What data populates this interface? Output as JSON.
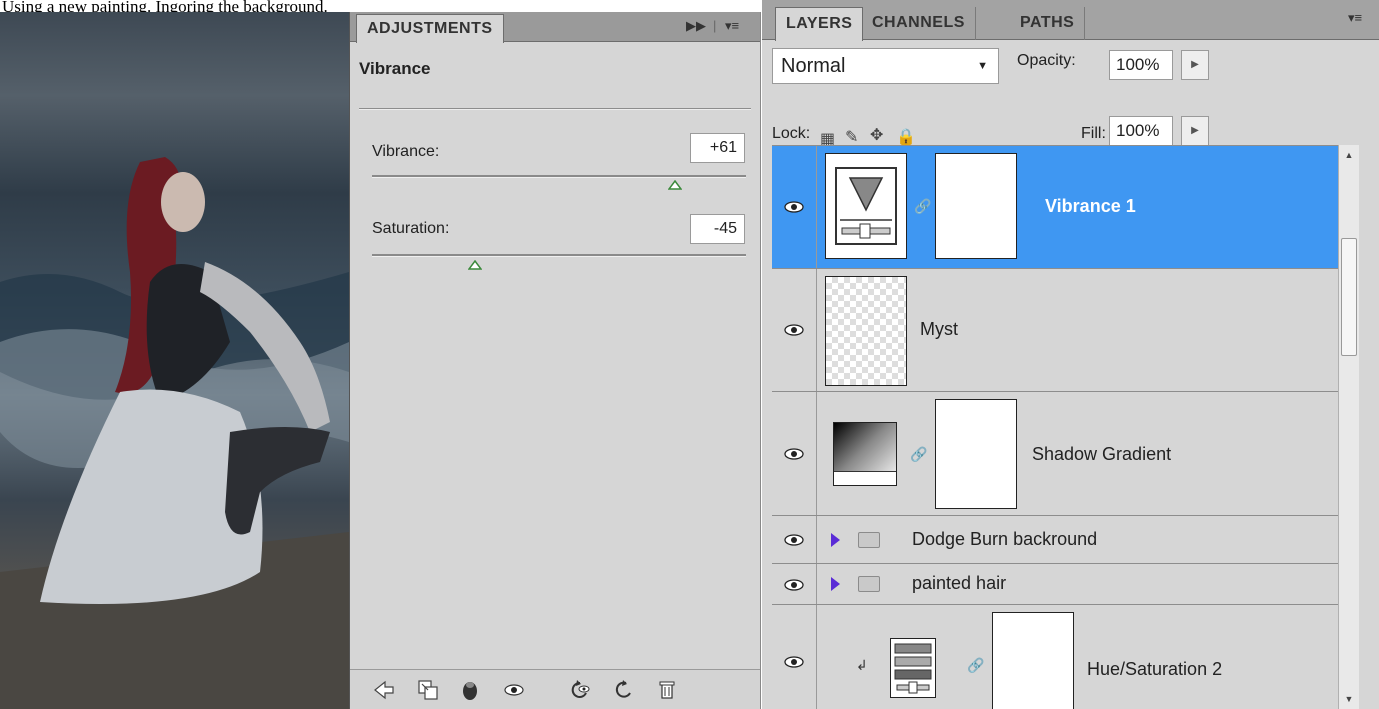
{
  "caption": "Using a new painting. Ingoring the background.",
  "adjustments": {
    "tab_label": "ADJUSTMENTS",
    "title": "Vibrance",
    "sliders": [
      {
        "label": "Vibrance:",
        "value": "+61",
        "position": 0.81
      },
      {
        "label": "Saturation:",
        "value": "-45",
        "position": 0.275
      }
    ],
    "footer_icons": [
      "back-arrow-icon",
      "expand-view-icon",
      "clip-to-layer-icon",
      "visibility-icon",
      "previous-state-icon",
      "reset-icon",
      "delete-icon"
    ]
  },
  "layers": {
    "tabs": [
      "LAYERS",
      "CHANNELS",
      "PATHS"
    ],
    "blend_mode": "Normal",
    "opacity_label": "Opacity:",
    "opacity_value": "100%",
    "lock_label": "Lock:",
    "fill_label": "Fill:",
    "fill_value": "100%",
    "rows": [
      {
        "name": "Vibrance 1",
        "selected": true
      },
      {
        "name": "Myst",
        "selected": false
      },
      {
        "name": "Shadow Gradient",
        "selected": false
      },
      {
        "name": "Dodge Burn backround",
        "selected": false
      },
      {
        "name": "painted hair",
        "selected": false
      },
      {
        "name": "Hue/Saturation 2",
        "selected": false
      }
    ]
  },
  "colors": {
    "selection": "#3f97f2",
    "panel_bg": "#d6d6d6",
    "thumb_green": "#3a8a3a"
  }
}
